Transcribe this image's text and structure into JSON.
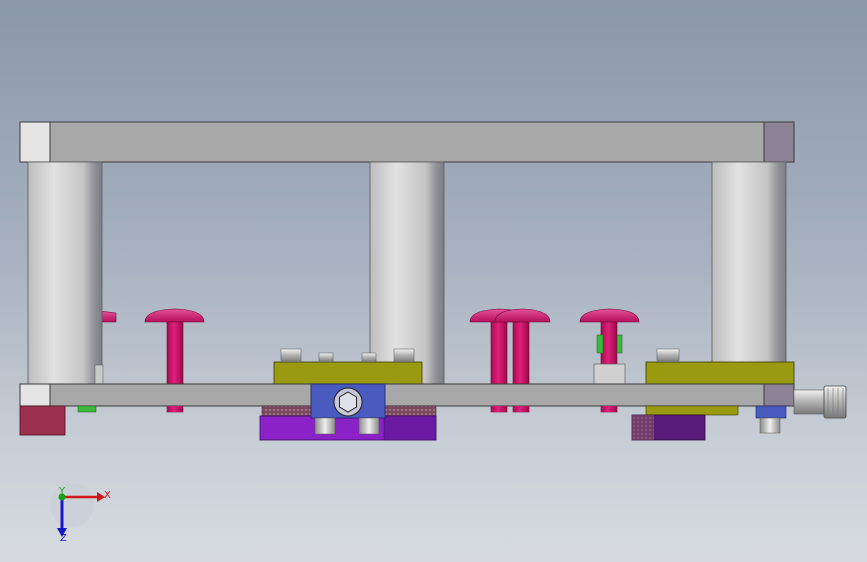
{
  "viewport": {
    "background_top": "#8b98aa",
    "background_bottom": "#d7dbe1"
  },
  "colors": {
    "plate_face": "#a9a9a9",
    "plate_end_left": "#e4e4e4",
    "plate_end_right": "#8c8295",
    "pillar": "#c8c8c8",
    "magenta_pin": "#d3156e",
    "olive_block": "#9a9a10",
    "blue_block": "#4a5bc0",
    "purple_block": "#8b22c8",
    "dark_purple_block": "#5a1a7a",
    "maroon_block": "#9c3050",
    "green_part": "#3cb83c",
    "bolt": "#b8b8b8"
  },
  "triad": {
    "x_label": "X",
    "y_label": "Y",
    "z_label": "Z",
    "x_color": "#d01818",
    "y_color": "#18a018",
    "z_color": "#1818c8"
  }
}
